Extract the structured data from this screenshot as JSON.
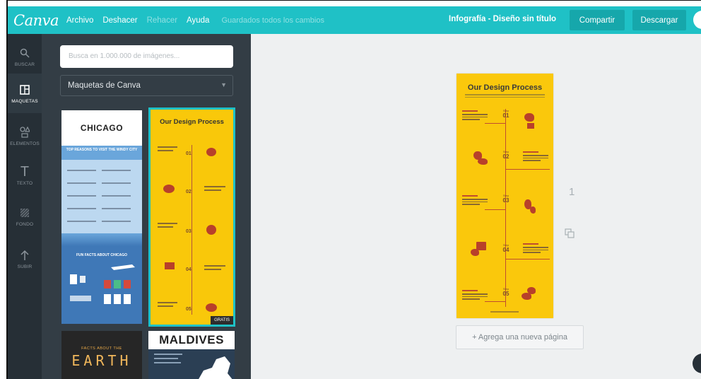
{
  "topbar": {
    "logo": "Canva",
    "menu": [
      "Archivo",
      "Deshacer",
      "Rehacer",
      "Ayuda"
    ],
    "saved_status": "Guardados todos los cambios",
    "doc_title": "Infografía - Diseño sin título",
    "share_label": "Compartir",
    "download_label": "Descargar"
  },
  "rail": {
    "items": [
      {
        "label": "BUSCAR",
        "icon": "search-icon"
      },
      {
        "label": "MAQUETAS",
        "icon": "layouts-icon"
      },
      {
        "label": "ELEMENTOS",
        "icon": "elements-icon"
      },
      {
        "label": "TEXTO",
        "icon": "text-icon"
      },
      {
        "label": "FONDO",
        "icon": "background-icon"
      },
      {
        "label": "SUBIR",
        "icon": "upload-icon"
      }
    ]
  },
  "panel": {
    "search_placeholder": "Busca en 1.000.000 de imágenes...",
    "select_value": "Maquetas de Canva",
    "templates": {
      "chicago_title": "CHICAGO",
      "chicago_band": "TOP REASONS TO VISIT THE WINDY CITY",
      "chicago_facts": "FUN FACTS ABOUT CHICAGO",
      "design_title": "Our Design Process",
      "gratis": "GRATIS",
      "earth_small": "FACTS ABOUT THE",
      "earth_big": "EARTH",
      "maldives_title": "MALDIVES"
    }
  },
  "canvas": {
    "page_title": "Our Design Process",
    "step_label": "Step",
    "steps": [
      "01",
      "02",
      "03",
      "04",
      "05"
    ],
    "page_number": "1",
    "add_page_label": "+ Agrega una nueva página"
  },
  "colors": {
    "accent": "#1fc1c6",
    "rail": "#262f36",
    "panel": "#333d45",
    "infographic": "#fac80c"
  }
}
